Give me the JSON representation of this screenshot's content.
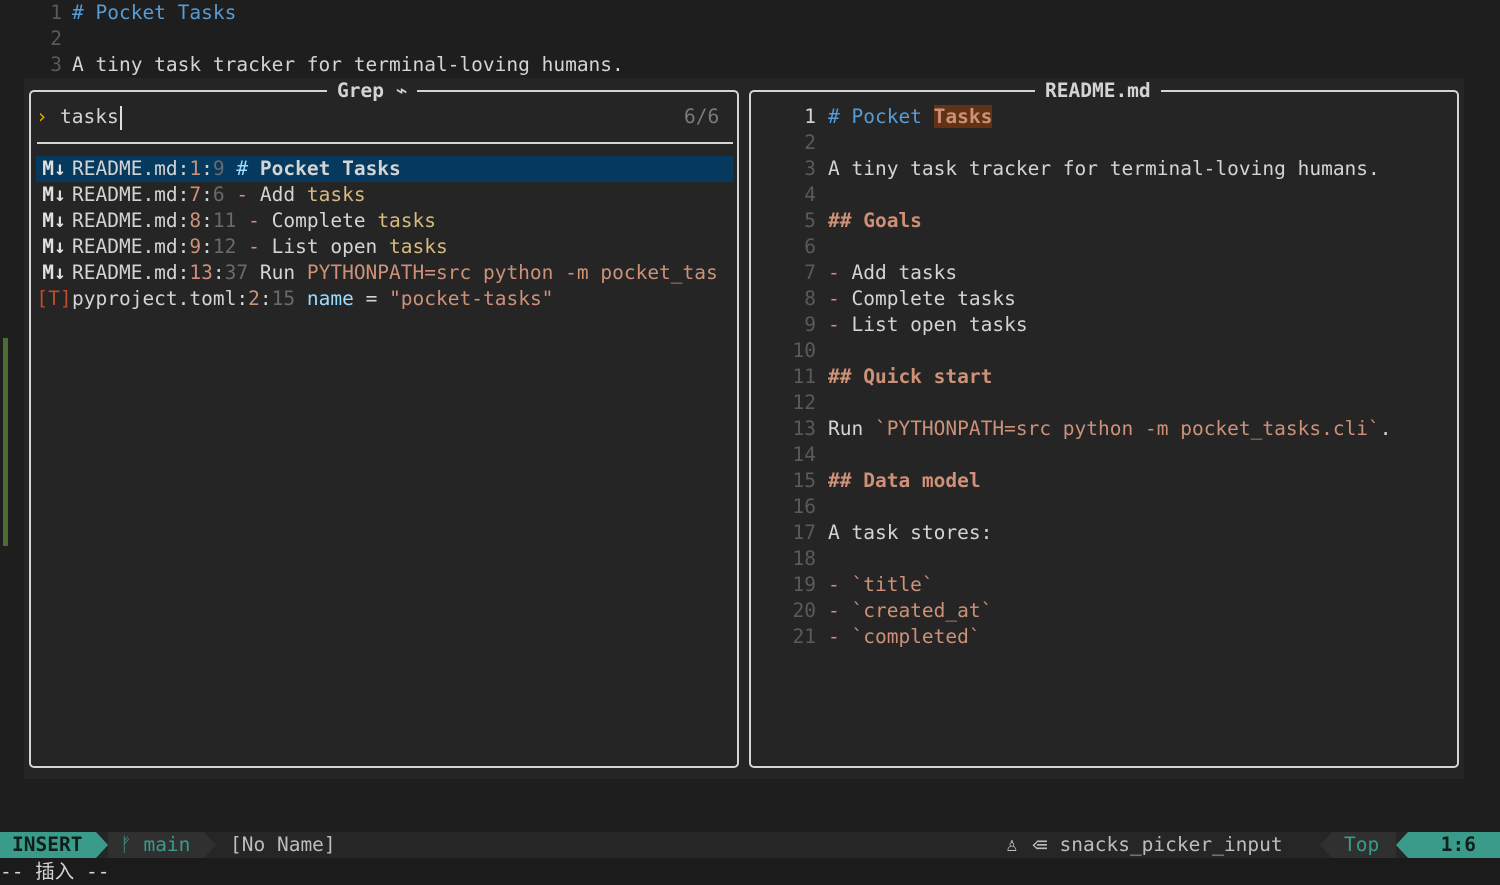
{
  "background_buffer": {
    "lines": [
      {
        "num": "1",
        "text": "# Pocket Tasks"
      },
      {
        "num": "2",
        "text": ""
      },
      {
        "num": "3",
        "text": "A tiny task tracker for terminal-loving humans."
      }
    ]
  },
  "picker": {
    "title": "Grep",
    "title_icon": "⌁",
    "prompt_symbol": "›",
    "query": "tasks",
    "count": "6/6",
    "results": [
      {
        "icon": "markdown-file-icon",
        "icon_glyph": "M↓",
        "file": "README.md",
        "line": "1",
        "col": "9",
        "text_a": "# ",
        "text_b": "Pocket Tasks",
        "kind": "title"
      },
      {
        "icon": "markdown-file-icon",
        "icon_glyph": "M↓",
        "file": "README.md",
        "line": "7",
        "col": "6",
        "text_a": "- ",
        "text_b": "Add ",
        "match": "tasks",
        "kind": "list"
      },
      {
        "icon": "markdown-file-icon",
        "icon_glyph": "M↓",
        "file": "README.md",
        "line": "8",
        "col": "11",
        "text_a": "- ",
        "text_b": "Complete ",
        "match": "tasks",
        "kind": "list"
      },
      {
        "icon": "markdown-file-icon",
        "icon_glyph": "M↓",
        "file": "README.md",
        "line": "9",
        "col": "12",
        "text_a": "- ",
        "text_b": "List open ",
        "match": "tasks",
        "kind": "list"
      },
      {
        "icon": "markdown-file-icon",
        "icon_glyph": "M↓",
        "file": "README.md",
        "line": "13",
        "col": "37",
        "text_a": "Run ",
        "text_b": "PYTHONPATH=src python -m pocket_tas",
        "kind": "code"
      },
      {
        "icon": "toml-file-icon",
        "icon_glyph": "[T]",
        "file": "pyproject.toml",
        "line": "2",
        "col": "15",
        "text_a": "name",
        "text_b": " = ",
        "match": "\"pocket-tasks\"",
        "kind": "toml"
      }
    ]
  },
  "preview": {
    "title": "README.md",
    "lines": [
      {
        "num": "1",
        "segs": [
          {
            "t": "# Pocket ",
            "c": "c-blue"
          },
          {
            "t": "Tasks",
            "c": "hl"
          }
        ]
      },
      {
        "num": "2",
        "segs": []
      },
      {
        "num": "3",
        "segs": [
          {
            "t": "A tiny task tracker for terminal-loving humans.",
            "c": "c-text"
          }
        ]
      },
      {
        "num": "4",
        "segs": []
      },
      {
        "num": "5",
        "segs": [
          {
            "t": "## Goals",
            "c": "c-head"
          }
        ]
      },
      {
        "num": "6",
        "segs": []
      },
      {
        "num": "7",
        "segs": [
          {
            "t": "- ",
            "c": "c-orange"
          },
          {
            "t": "Add tasks",
            "c": "c-text"
          }
        ]
      },
      {
        "num": "8",
        "segs": [
          {
            "t": "- ",
            "c": "c-orange"
          },
          {
            "t": "Complete tasks",
            "c": "c-text"
          }
        ]
      },
      {
        "num": "9",
        "segs": [
          {
            "t": "- ",
            "c": "c-orange"
          },
          {
            "t": "List open tasks",
            "c": "c-text"
          }
        ]
      },
      {
        "num": "10",
        "segs": []
      },
      {
        "num": "11",
        "segs": [
          {
            "t": "## Quick start",
            "c": "c-head"
          }
        ]
      },
      {
        "num": "12",
        "segs": []
      },
      {
        "num": "13",
        "segs": [
          {
            "t": "Run ",
            "c": "c-text"
          },
          {
            "t": "`PYTHONPATH=src python -m pocket_tasks.cli`",
            "c": "c-orange"
          },
          {
            "t": ".",
            "c": "c-text"
          }
        ]
      },
      {
        "num": "14",
        "segs": []
      },
      {
        "num": "15",
        "segs": [
          {
            "t": "## Data model",
            "c": "c-head"
          }
        ]
      },
      {
        "num": "16",
        "segs": []
      },
      {
        "num": "17",
        "segs": [
          {
            "t": "A task stores:",
            "c": "c-text"
          }
        ]
      },
      {
        "num": "18",
        "segs": []
      },
      {
        "num": "19",
        "segs": [
          {
            "t": "- ",
            "c": "c-orange"
          },
          {
            "t": "`title`",
            "c": "c-orange"
          }
        ]
      },
      {
        "num": "20",
        "segs": [
          {
            "t": "- ",
            "c": "c-orange"
          },
          {
            "t": "`created_at`",
            "c": "c-orange"
          }
        ]
      },
      {
        "num": "21",
        "segs": [
          {
            "t": "- ",
            "c": "c-orange"
          },
          {
            "t": "`completed`",
            "c": "c-orange"
          }
        ]
      }
    ]
  },
  "statusline": {
    "mode": "INSERT",
    "branch_icon": "ᚠ",
    "branch": "main",
    "filename": "[No Name]",
    "lsp_icon": "♙",
    "filetype_icon": "≡",
    "filetype": "snacks_picker_input",
    "scroll": "Top",
    "position": "1:6"
  },
  "cmdline": "-- 插入 --",
  "colors": {
    "mode_accent": "#3a9b8a",
    "selection": "#053a5e",
    "match": "#d7ba7d",
    "heading": "#ce9178"
  }
}
